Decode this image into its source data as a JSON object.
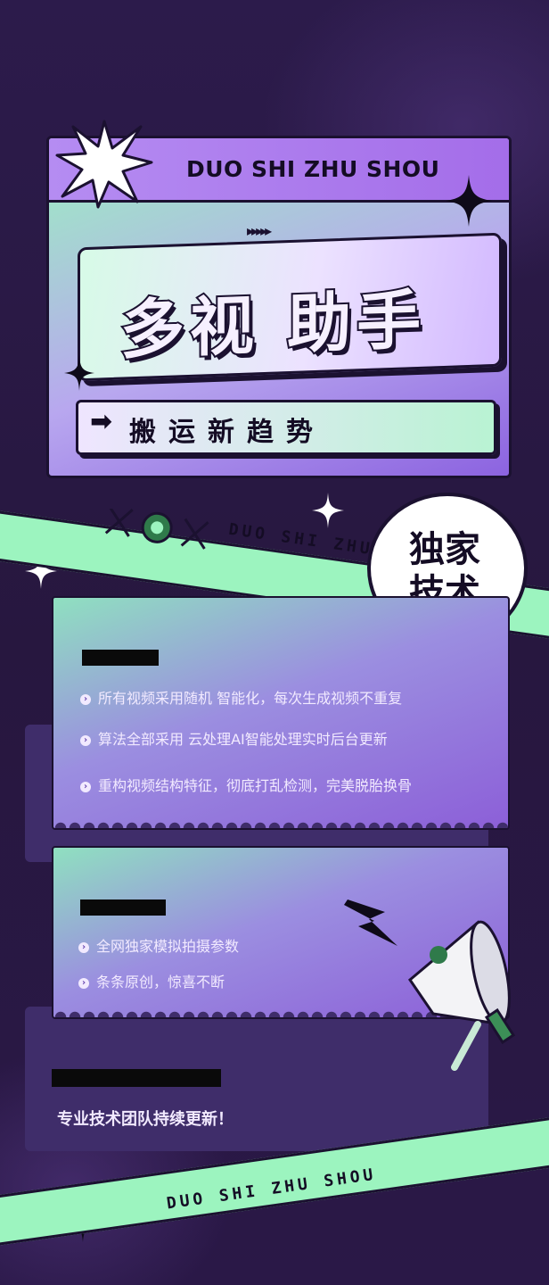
{
  "header": {
    "brand": "DUO SHI ZHU SHOU",
    "arrows": "▸▸▸▸▸",
    "title": "多视 助手",
    "subtitle_arrow": "➡",
    "subtitle": "搬运新趋势"
  },
  "ribbons": {
    "top_text": "DUO SHI ZHU",
    "bottom_text": "DUO SHI ZHU SHOU"
  },
  "bubble": {
    "line1": "独家",
    "line2": "技术"
  },
  "card1": {
    "items": [
      "所有视频采用随机 智能化，每次生成视频不重复",
      "算法全部采用 云处理AI智能处理实时后台更新",
      "重构视频结构特征，彻底打乱检测，完美脱胎换骨"
    ]
  },
  "card2": {
    "items": [
      "全网独家模拟拍摄参数",
      "条条原创，惊喜不断"
    ]
  },
  "footer": {
    "text": "专业技术团队持续更新！"
  },
  "colors": {
    "background": "#2a1a48",
    "mint": "#9cf4bf",
    "lavender": "#b58cf2",
    "ink": "#1b1130"
  }
}
